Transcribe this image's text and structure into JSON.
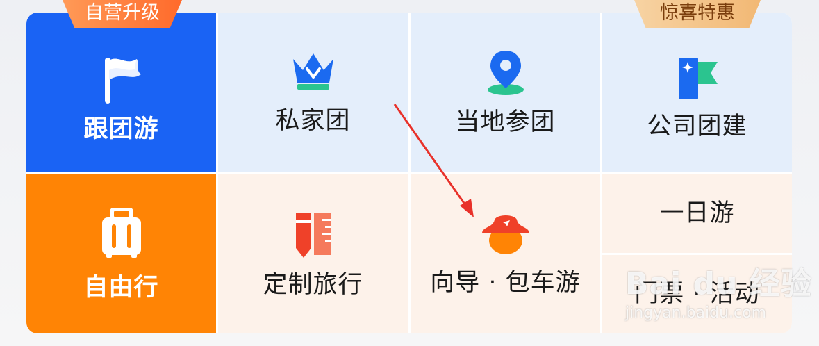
{
  "badges": {
    "left": "自营升级",
    "right": "惊喜特惠"
  },
  "tiles": {
    "group_tour": "跟团游",
    "private_tour": "私家团",
    "local_join": "当地参团",
    "company_team": "公司团建",
    "free_travel": "自由行",
    "custom_travel": "定制旅行",
    "guide_car": "向导 · 包车游",
    "day_tour": "一日游",
    "tickets": "门票 · 活动"
  },
  "watermark": {
    "brand": "Bai du 经验",
    "url": "jingyan.baidu.com"
  },
  "colors": {
    "group_tour_bg": "#1a63f4",
    "free_travel_bg": "#ff8405",
    "top_row_bg": "#e4eefb",
    "bottom_row_bg": "#fdf2ea",
    "arrow": "#e8312a"
  },
  "icons": {
    "group_tour": "flag-icon",
    "private_tour": "crown-icon",
    "local_join": "location-pin-icon",
    "company_team": "team-flag-icon",
    "free_travel": "suitcase-icon",
    "custom_travel": "ruler-pencil-icon",
    "guide_car": "guide-hat-icon"
  }
}
